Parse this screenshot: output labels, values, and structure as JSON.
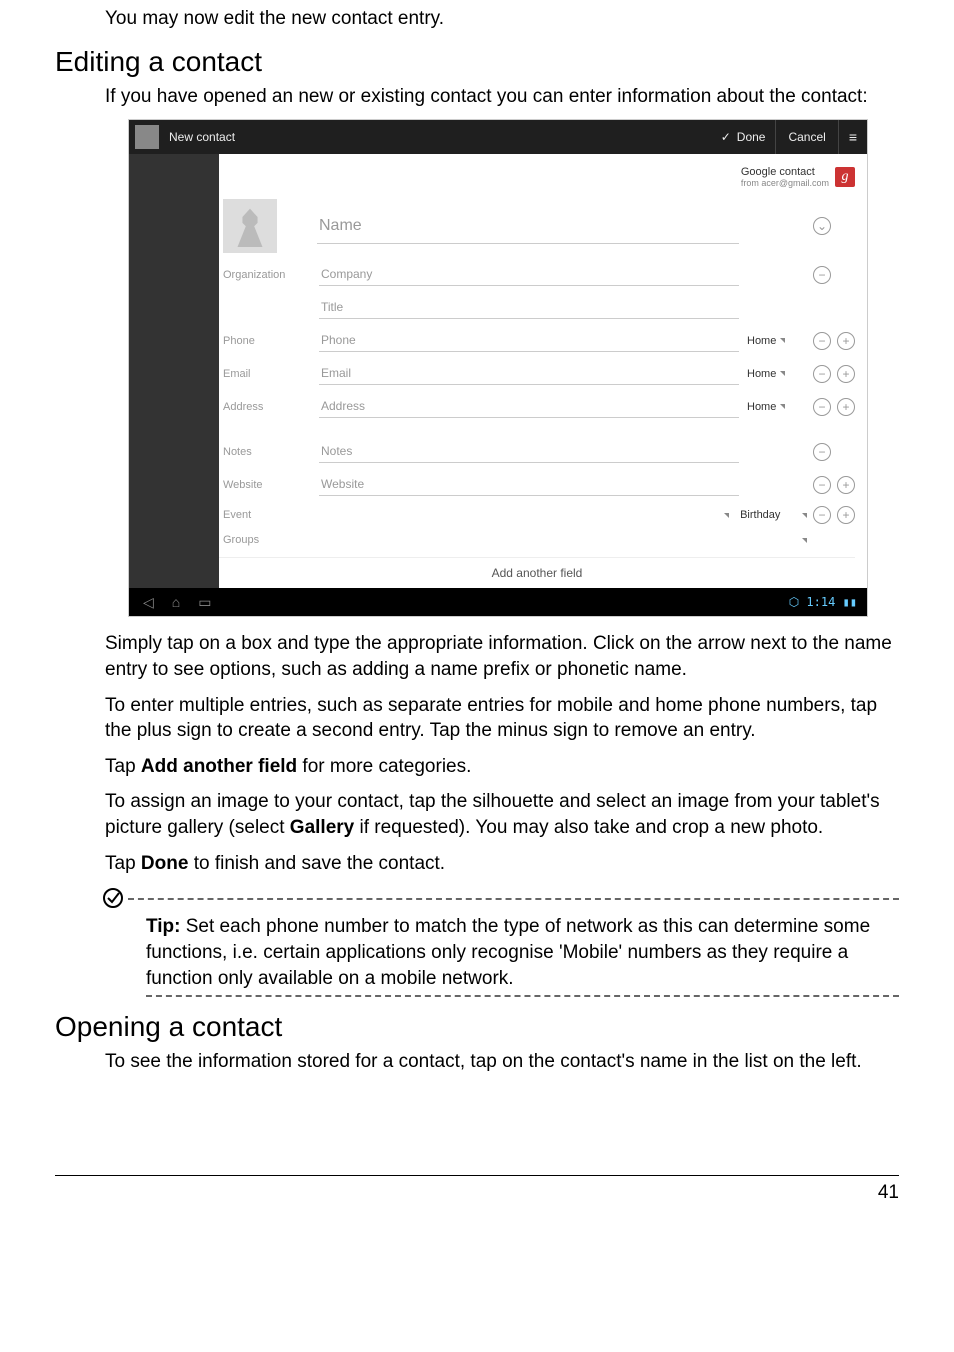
{
  "intro_line": "You may now edit the new contact entry.",
  "h_edit": "Editing a contact",
  "p_edit_intro": "If you have opened an new or existing contact you can enter information about the contact:",
  "screenshot": {
    "title": "New contact",
    "done": "Done",
    "cancel": "Cancel",
    "account_label": "Google contact",
    "account_sub": "from acer@gmail.com",
    "fields": {
      "name": "Name",
      "org_label": "Organization",
      "company": "Company",
      "title_ph": "Title",
      "phone_label": "Phone",
      "phone_ph": "Phone",
      "phone_type": "Home",
      "email_label": "Email",
      "email_ph": "Email",
      "email_type": "Home",
      "address_label": "Address",
      "address_ph": "Address",
      "address_type": "Home",
      "notes_label": "Notes",
      "notes_ph": "Notes",
      "website_label": "Website",
      "website_ph": "Website",
      "event_label": "Event",
      "event_type": "Birthday",
      "groups_label": "Groups",
      "add_another": "Add another field"
    },
    "status_time": "1:14"
  },
  "p_after1": "Simply tap on a box and type the appropriate information. Click on the arrow next to the name entry to see options, such as adding a name prefix or phonetic name.",
  "p_after2": "To enter multiple entries, such as separate entries for mobile and home phone numbers, tap the plus sign to create a second entry. Tap the minus sign to remove an entry.",
  "p_after3_pre": "Tap ",
  "p_after3_bold": "Add another field",
  "p_after3_post": " for more categories.",
  "p_assign_pre": "To assign an image to your contact, tap the silhouette and select an image from your tablet's picture gallery (select ",
  "p_assign_bold": "Gallery",
  "p_assign_post": " if requested). You may also take and crop a new photo.",
  "p_done_pre": "Tap ",
  "p_done_bold": "Done",
  "p_done_post": " to finish and save the contact.",
  "tip": {
    "label": "Tip:",
    "text": " Set each phone number to match the type of network as this can determine some functions, i.e. certain applications only recognise 'Mobile' numbers as they require a function only available on a mobile network."
  },
  "h_open": "Opening a contact",
  "p_open": "To see the information stored for a contact, tap on the contact's name in the list on the left.",
  "page_num": "41"
}
